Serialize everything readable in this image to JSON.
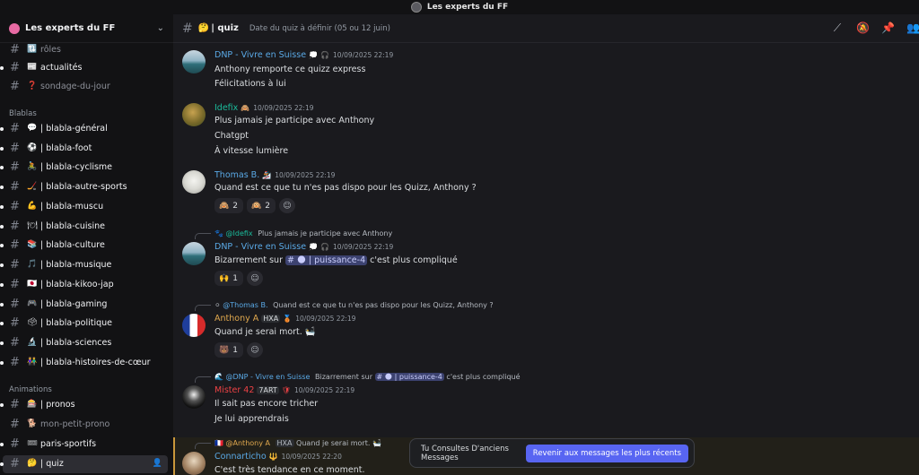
{
  "window": {
    "title": "Les experts du FF"
  },
  "server": {
    "name": "Les experts du FF"
  },
  "sidebar": {
    "top_channels": [
      {
        "emoji": "🔃",
        "label": "rôles",
        "muted": true
      },
      {
        "emoji": "📰",
        "label": "actualités",
        "muted": false
      },
      {
        "emoji": "❓",
        "label": "sondage-du-jour",
        "muted": true
      }
    ],
    "cat_blablas": "Blablas",
    "blablas": [
      {
        "emoji": "💬",
        "label": "| blabla-général"
      },
      {
        "emoji": "⚽",
        "label": "| blabla-foot"
      },
      {
        "emoji": "🚴",
        "label": "| blabla-cyclisme"
      },
      {
        "emoji": "🏒",
        "label": "| blabla-autre-sports"
      },
      {
        "emoji": "💪",
        "label": "| blabla-muscu"
      },
      {
        "emoji": "🍽",
        "label": "| blabla-cuisine"
      },
      {
        "emoji": "📚",
        "label": "| blabla-culture"
      },
      {
        "emoji": "🎵",
        "label": "| blabla-musique"
      },
      {
        "emoji": "🇯🇵",
        "label": "| blabla-kikoo-jap"
      },
      {
        "emoji": "🎮",
        "label": "| blabla-gaming"
      },
      {
        "emoji": "🗳",
        "label": "| blabla-politique"
      },
      {
        "emoji": "🔬",
        "label": "| blabla-sciences"
      },
      {
        "emoji": "👫",
        "label": "| blabla-histoires-de-cœur"
      }
    ],
    "cat_animations": "Animations",
    "animations": [
      {
        "emoji": "🎰",
        "label": "| pronos",
        "muted": false
      },
      {
        "emoji": "🐕",
        "label": "mon-petit-prono",
        "muted": true
      },
      {
        "emoji": "🎟",
        "label": "paris-sportifs",
        "muted": false
      },
      {
        "emoji": "🤔",
        "label": "| quiz",
        "muted": false,
        "active": true
      }
    ]
  },
  "header": {
    "emoji": "🤔",
    "name": "| quiz",
    "topic": "Date du quiz à définir (05 ou 12 juin)",
    "icons": [
      "threads-icon",
      "notifications-muted-icon",
      "pinned-icon",
      "members-icon"
    ]
  },
  "messages": [
    {
      "author": "DNP - Vivre en Suisse",
      "color": "#5aa9e6",
      "badge": "💭",
      "ts": "10/09/2025 22:19",
      "lines": [
        "Anthony remporte ce quizz express",
        "Félicitations à lui"
      ]
    },
    {
      "author": "Idefix",
      "color": "#1abc9c",
      "badge": "🙈",
      "ts": "10/09/2025 22:19",
      "lines": [
        "Plus jamais je participe avec Anthony",
        "Chatgpt",
        "À vitesse lumière"
      ]
    },
    {
      "author": "Thomas B.",
      "color": "#5aa9e6",
      "badge": "🏂",
      "ts": "10/09/2025 22:19",
      "lines": [
        "Quand est ce que tu n'es pas dispo pour les Quizz, Anthony ?"
      ],
      "reactions": [
        {
          "emoji": "🙈",
          "count": "2"
        },
        {
          "emoji": "🙉",
          "count": "2"
        }
      ]
    },
    {
      "reply_name": "@Idefix",
      "reply_text": "Plus jamais je participe avec Anthony",
      "author": "DNP - Vivre en Suisse",
      "color": "#5aa9e6",
      "badge": "💭",
      "ts": "10/09/2025 22:19",
      "line_pre": "Bizarrement sur ",
      "mention": "# 🌑 | puissance-4",
      "line_post": " c'est plus compliqué",
      "reactions": [
        {
          "emoji": "🙌",
          "count": "1"
        }
      ]
    },
    {
      "reply_name": "@Thomas B.",
      "reply_text": "Quand est ce que tu n'es pas dispo pour les Quizz, Anthony ?",
      "author": "Anthony A",
      "color": "#e0a84e",
      "tag": "HXA",
      "ts": "10/09/2025 22:19",
      "lines": [
        "Quand je serai mort. 🛀"
      ],
      "reactions": [
        {
          "emoji": "🐻",
          "count": "1"
        }
      ]
    },
    {
      "reply_name": "@DNP - Vivre en Suisse",
      "reply_pre": "Bizarrement sur ",
      "reply_mention": "# 🌑 | puissance-4",
      "reply_post": " c'est plus compliqué",
      "author": "Mister 42",
      "color": "#ed4245",
      "tag": "7ART",
      "ts": "10/09/2025 22:19",
      "lines": [
        "Il sait pas encore tricher",
        "Je lui apprendrais"
      ]
    },
    {
      "reply_name": "@Anthony A",
      "reply_tag": "HXA",
      "reply_text": "Quand je serai mort. 🛀",
      "author": "Connarticho",
      "color": "#5aa9e6",
      "badge": "🔱",
      "ts": "10/09/2025 22:20",
      "lines": [
        "C'est très tendance en ce moment."
      ]
    }
  ],
  "jumpbar": {
    "text": "Tu Consultes D'anciens Messages",
    "button": "Revenir aux messages les plus récents"
  }
}
